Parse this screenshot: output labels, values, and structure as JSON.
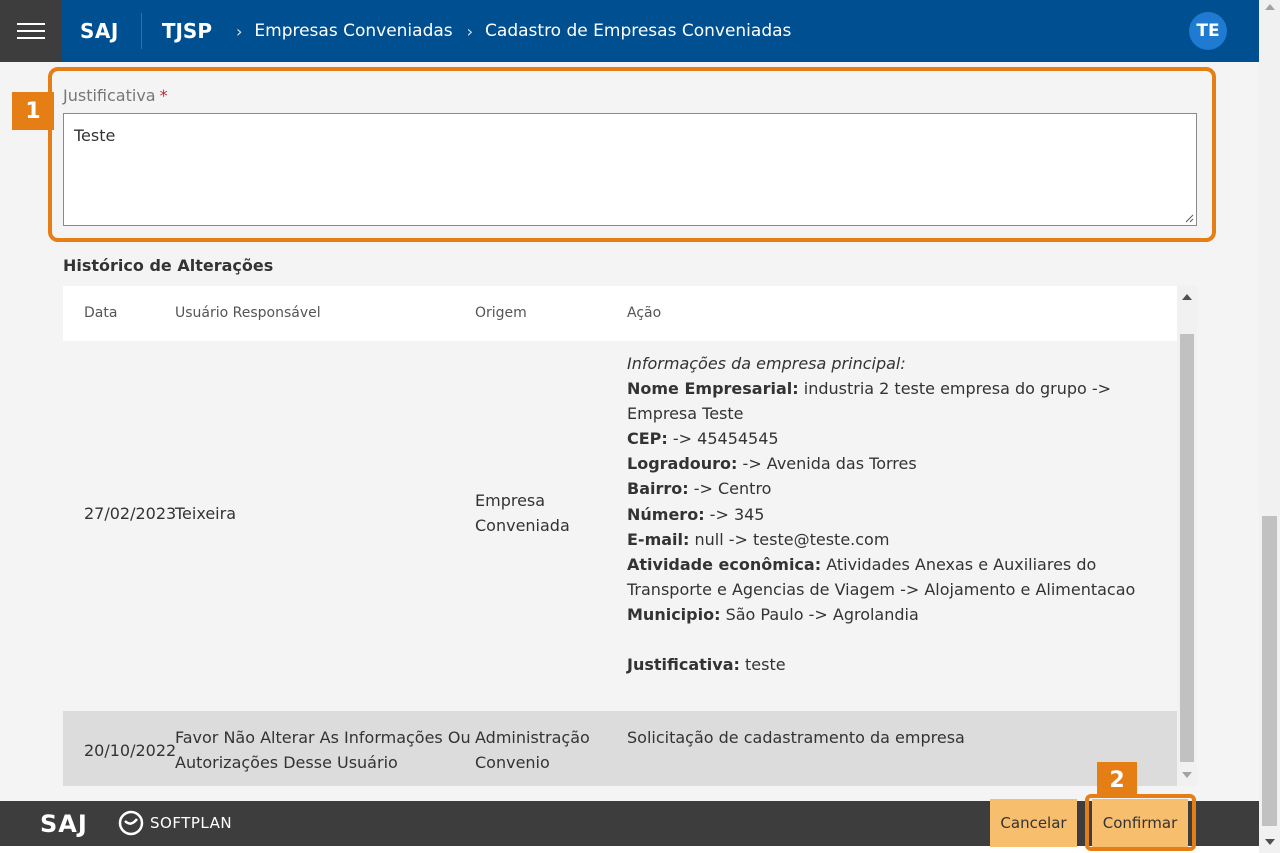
{
  "header": {
    "brand": "SAJ",
    "brand2": "TJSP",
    "breadcrumbs": [
      "Empresas Conveniadas",
      "Cadastro de Empresas Conveniadas"
    ],
    "avatar_initials": "TE"
  },
  "markers": [
    "1",
    "2"
  ],
  "justificativa": {
    "label": "Justificativa",
    "required_mark": "*",
    "value": "Teste"
  },
  "history": {
    "title": "Histórico de Alterações",
    "columns": [
      "Data",
      "Usuário Responsável",
      "Origem",
      "Ação"
    ],
    "rows": [
      {
        "date": "27/02/2023",
        "user": "Teixeira",
        "origin": "Empresa Conveniada",
        "action": {
          "intro": "Informações da empresa principal:",
          "items": [
            {
              "label": "Nome Empresarial:",
              "value": " industria 2 teste empresa do grupo -> Empresa Teste"
            },
            {
              "label": "CEP:",
              "value": " -> 45454545"
            },
            {
              "label": "Logradouro:",
              "value": " -> Avenida das Torres"
            },
            {
              "label": "Bairro:",
              "value": " -> Centro"
            },
            {
              "label": "Número:",
              "value": " -> 345"
            },
            {
              "label": "E-mail:",
              "value": " null -> teste@teste.com"
            },
            {
              "label": "Atividade econômica:",
              "value": " Atividades Anexas e Auxiliares do Transporte e Agencias de Viagem -> Alojamento e Alimentacao"
            },
            {
              "label": "Municipio:",
              "value": " São Paulo -> Agrolandia"
            }
          ],
          "justification_label": "Justificativa:",
          "justification_value": " teste"
        }
      },
      {
        "date": "20/10/2022",
        "user": "Favor Não Alterar As Informações Ou Autorizações Desse Usuário",
        "origin": "Administração Convenio",
        "action_text": "Solicitação de cadastramento da empresa"
      }
    ]
  },
  "footer": {
    "saj": "SAJ",
    "softplan": "SOFTPLAN",
    "cancel_label": "Cancelar",
    "confirm_label": "Confirmar"
  },
  "colors": {
    "header_bg": "#004f91",
    "accent_highlight": "#e67e16",
    "button_bg": "#f7be6e",
    "footer_bg": "#3d3d3d"
  }
}
